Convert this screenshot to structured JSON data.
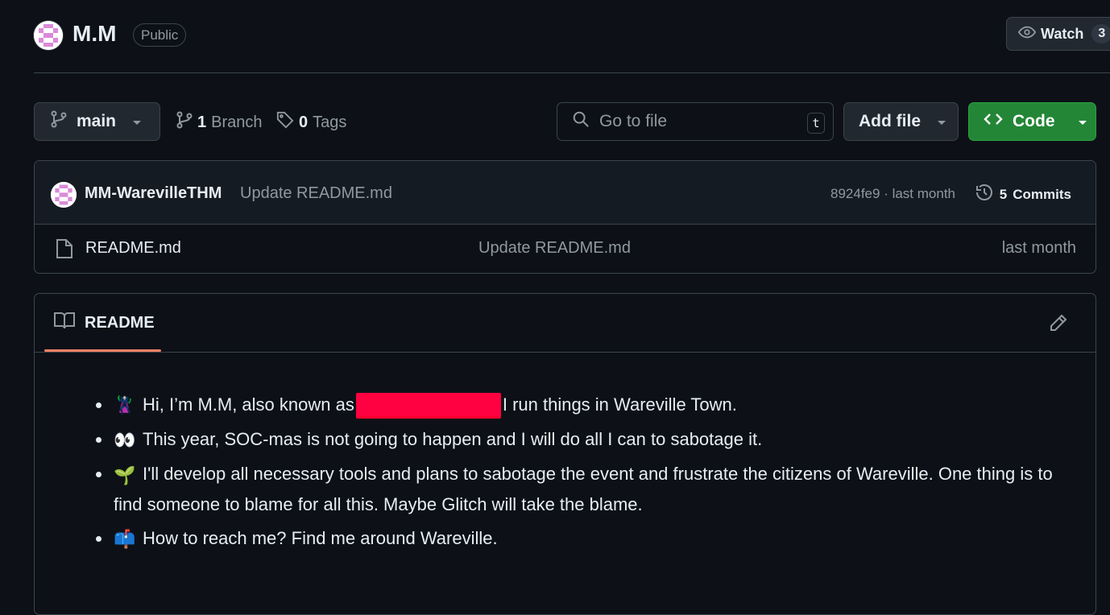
{
  "repo": {
    "name": "M.M",
    "visibility": "Public",
    "watch_label": "Watch",
    "watch_count": "3"
  },
  "toolbar": {
    "branch": "main",
    "branch_count": "1",
    "branch_label": "Branch",
    "tag_count": "0",
    "tag_label": "Tags",
    "search_placeholder": "Go to file",
    "search_shortcut": "t",
    "add_file": "Add file",
    "code": "Code"
  },
  "latest_commit": {
    "author": "MM-WarevilleTHM",
    "message": "Update README.md",
    "sha_time": "8924fe9 · last month",
    "commits_count": "5",
    "commits_label": "Commits"
  },
  "files": [
    {
      "name": "README.md",
      "commit_message": "Update README.md",
      "time": "last month"
    }
  ],
  "readme": {
    "tab_label": "README",
    "items": [
      {
        "emoji": "🦹",
        "text_before": "Hi, I’m M.M, also known as",
        "text_after": "I run things in Wareville Town."
      },
      {
        "emoji": "👀",
        "text": "This year, SOC-mas is not going to happen and I will do all I can to sabotage it."
      },
      {
        "emoji": "🌱",
        "text": "I'll develop all necessary tools and plans to sabotage the event and frustrate the citizens of Wareville. One thing is to find someone to blame for all this. Maybe Glitch will take the blame."
      },
      {
        "emoji": "📫",
        "text": "How to reach me? Find me around Wareville."
      }
    ]
  },
  "colors": {
    "background": "#0d1117",
    "border": "#3d444d",
    "code_button": "#238636",
    "tab_underline": "#f78166",
    "redaction": "#ff0040"
  }
}
